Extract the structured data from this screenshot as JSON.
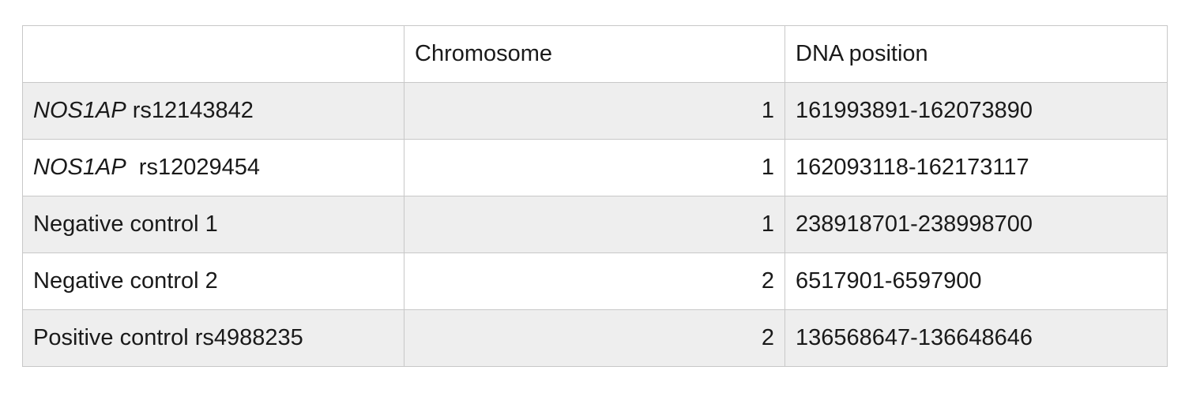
{
  "table": {
    "headers": {
      "label": "",
      "chromosome": "Chromosome",
      "dna_position": "DNA position"
    },
    "rows": [
      {
        "gene": "NOS1AP",
        "label_rest": " rs12143842",
        "chromosome": "1",
        "dna_position": "161993891-162073890"
      },
      {
        "gene": "NOS1AP",
        "label_rest": "  rs12029454",
        "chromosome": "1",
        "dna_position": "162093118-162173117"
      },
      {
        "gene": "",
        "label_rest": "Negative control 1",
        "chromosome": "1",
        "dna_position": "238918701-238998700"
      },
      {
        "gene": "",
        "label_rest": "Negative control 2",
        "chromosome": "2",
        "dna_position": "6517901-6597900"
      },
      {
        "gene": "",
        "label_rest": "Positive control rs4988235",
        "chromosome": "2",
        "dna_position": "136568647-136648646"
      }
    ]
  }
}
